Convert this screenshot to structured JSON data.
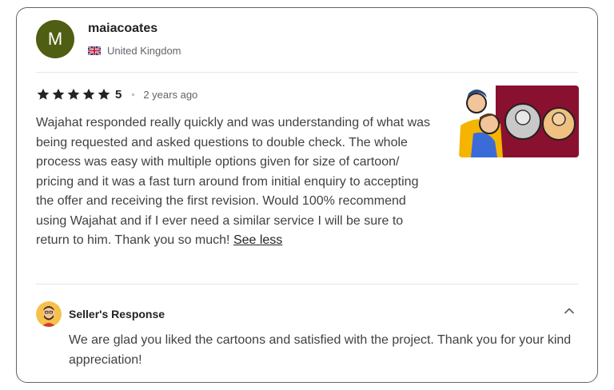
{
  "reviewer": {
    "initial": "M",
    "avatar_color": "#4e5e12",
    "username": "maiacoates",
    "country": "United Kingdom",
    "flag_icon": "uk-flag-icon"
  },
  "rating": {
    "stars": 5,
    "value": "5",
    "time_ago": "2 years ago"
  },
  "review": {
    "text": "Wajahat responded really quickly and was understanding of what was being requested and asked questions to double check. The whole process was easy with multiple options given for size of cartoon/ pricing and it was a fast turn around from initial enquiry to accepting the offer and receiving the first revision. Would 100% recommend using Wajahat and if I ever need a similar service I will be sure to return to him. Thank you so much!",
    "toggle_label": "See less"
  },
  "seller_response": {
    "title": "Seller's Response",
    "text": "We are glad you liked the cartoons and satisfied with the project. Thank you for your kind appreciation!"
  }
}
